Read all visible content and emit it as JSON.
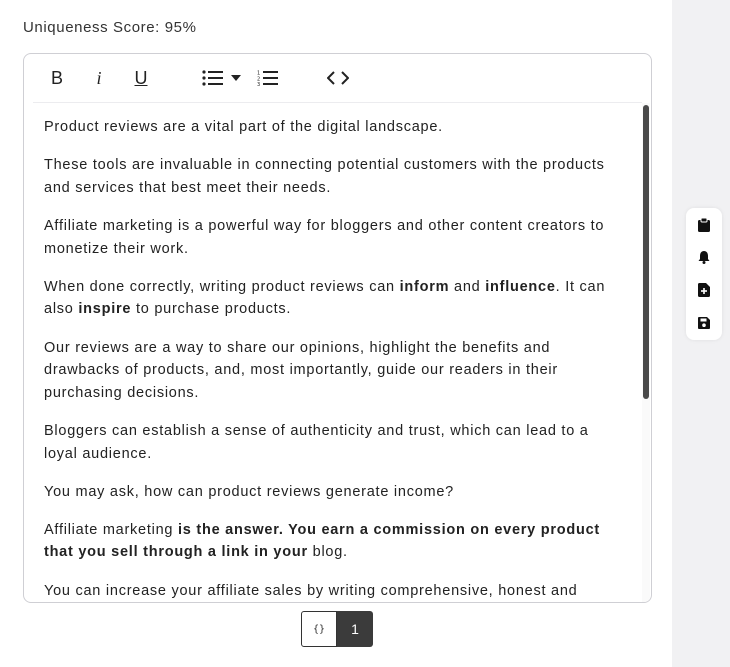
{
  "score": {
    "label": "Uniqueness Score: 95%"
  },
  "toolbar": {
    "bold": "B",
    "italic": "i",
    "underline": "U",
    "icons": [
      "bullet-list-icon",
      "chevron-down-icon",
      "ordered-list-icon",
      "code-icon"
    ]
  },
  "content": {
    "paragraphs": [
      [
        {
          "t": "Product reviews are a vital part of the digital landscape."
        }
      ],
      [
        {
          "t": "These tools are invaluable in connecting potential customers with the products and services that best meet their needs."
        }
      ],
      [
        {
          "t": "Affiliate marketing is a powerful way for bloggers and other content creators to monetize their work."
        }
      ],
      [
        {
          "t": "When done correctly, writing product reviews can "
        },
        {
          "t": "inform",
          "b": true
        },
        {
          "t": " and "
        },
        {
          "t": "influence",
          "b": true
        },
        {
          "t": ". It can also "
        },
        {
          "t": "inspire",
          "b": true
        },
        {
          "t": " to purchase products."
        }
      ],
      [
        {
          "t": "Our reviews are a way to share our opinions, highlight the benefits and drawbacks of products, and, most importantly, guide our readers in their purchasing decisions."
        }
      ],
      [
        {
          "t": "Bloggers can establish a sense of authenticity and trust, which can lead to a loyal audience."
        }
      ],
      [
        {
          "t": "You may ask, how can product reviews generate income?"
        }
      ],
      [
        {
          "t": "Affiliate marketing "
        },
        {
          "t": "is the answer. You earn a commission on every product that you sell through a link in your",
          "b": true
        },
        {
          "t": " blog."
        }
      ],
      [
        {
          "t": "You can increase your affiliate sales by writing comprehensive, honest and"
        }
      ]
    ]
  },
  "pager": {
    "code_label": "{}",
    "page": "1"
  },
  "side_actions": [
    "clipboard-icon",
    "bell-icon",
    "file-add-icon",
    "save-icon"
  ],
  "colors": {
    "accent_dark": "#3b3b3b",
    "strip_bg": "#f1f1f3",
    "border": "#cfcfd4"
  }
}
